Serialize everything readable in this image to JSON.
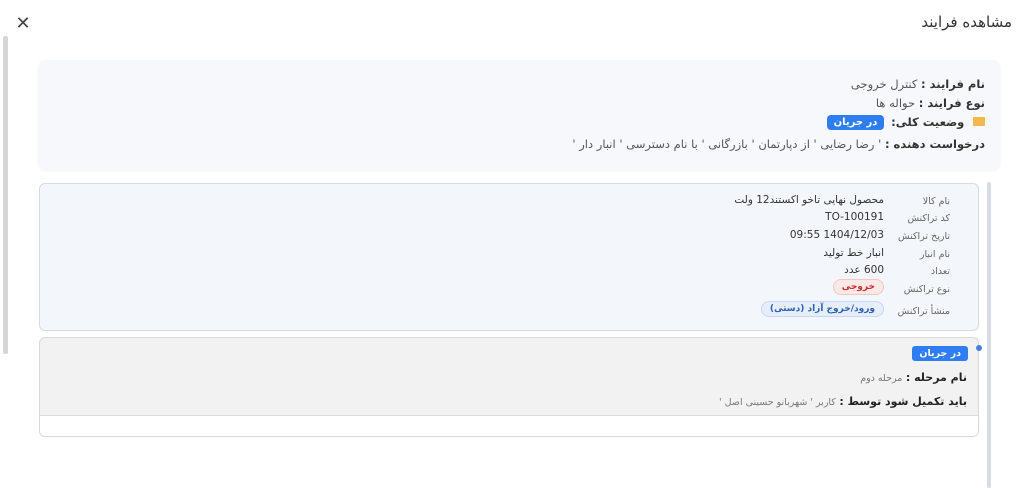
{
  "modal": {
    "title": "مشاهده فرایند",
    "close_icon": "close-icon"
  },
  "process": {
    "name_label": "نام فرایند :",
    "name_value": "کنترل خروجی",
    "type_label": "نوع فرایند :",
    "type_value": "حواله ها",
    "status_label": "وضعیت کلی:",
    "status_value": "در جریان",
    "requester_label": "درخواست دهنده :",
    "requester_value": "' رضا رضایی ' از دپارتمان ' بازرگانی ' با نام دسترسی ' انبار دار '"
  },
  "details": {
    "rows": [
      {
        "label": "نام کالا",
        "value": "محصول نهایی تاخو اکستند12 ولت"
      },
      {
        "label": "کد تراکنش",
        "value": "TO-100191"
      },
      {
        "label": "تاریخ تراکنش",
        "value": "1404/12/03 09:55"
      },
      {
        "label": "نام انبار",
        "value": "انبار خط تولید"
      },
      {
        "label": "تعداد",
        "value": "600 عدد"
      },
      {
        "label": "نوع تراکنش",
        "value": "خروجی"
      },
      {
        "label": "منشأ تراکنش",
        "value": "ورود/خروج آزاد (دستی)"
      }
    ]
  },
  "step": {
    "status_badge": "در جریان",
    "name_label": "نام مرحله :",
    "name_value": "مرحله دوم",
    "assignee_label": "باید تکمیل شود توسط :",
    "assignee_value": "کاربر ' شهربانو حسینی اصل '"
  },
  "colors": {
    "accent": "#2f7df2",
    "danger_pill_bg": "#fde8e8",
    "info_pill_bg": "#e6eefc",
    "folder": "#f2b84b"
  }
}
